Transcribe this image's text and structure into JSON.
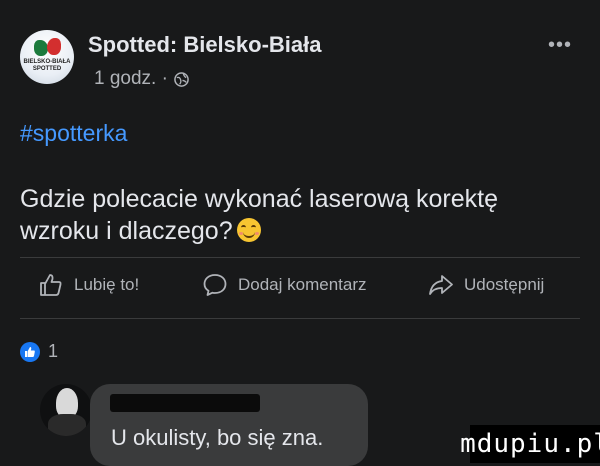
{
  "post": {
    "page_name": "Spotted: Bielsko-Biała",
    "time": "1 godz. ·",
    "more_label": "•••",
    "hashtag": "#spotterka",
    "text": "Gdzie polecacie wykonać laserową korektę wzroku i dlaczego?",
    "avatar_label": "BIELSKO-BIAŁA SPOTTED",
    "emoji": "smiling-face-icon"
  },
  "actions": {
    "like": "Lubię to!",
    "comment": "Dodaj komentarz",
    "share": "Udostępnij"
  },
  "reactions": {
    "count": "1",
    "icon": "like-icon"
  },
  "comment": {
    "text": "U okulisty, bo się zna."
  },
  "watermark": "mdupiu.pl",
  "colors": {
    "background": "#18191a",
    "hashtag": "#4599ff",
    "like_badge": "#1877f2",
    "bubble": "#3a3b3c"
  }
}
